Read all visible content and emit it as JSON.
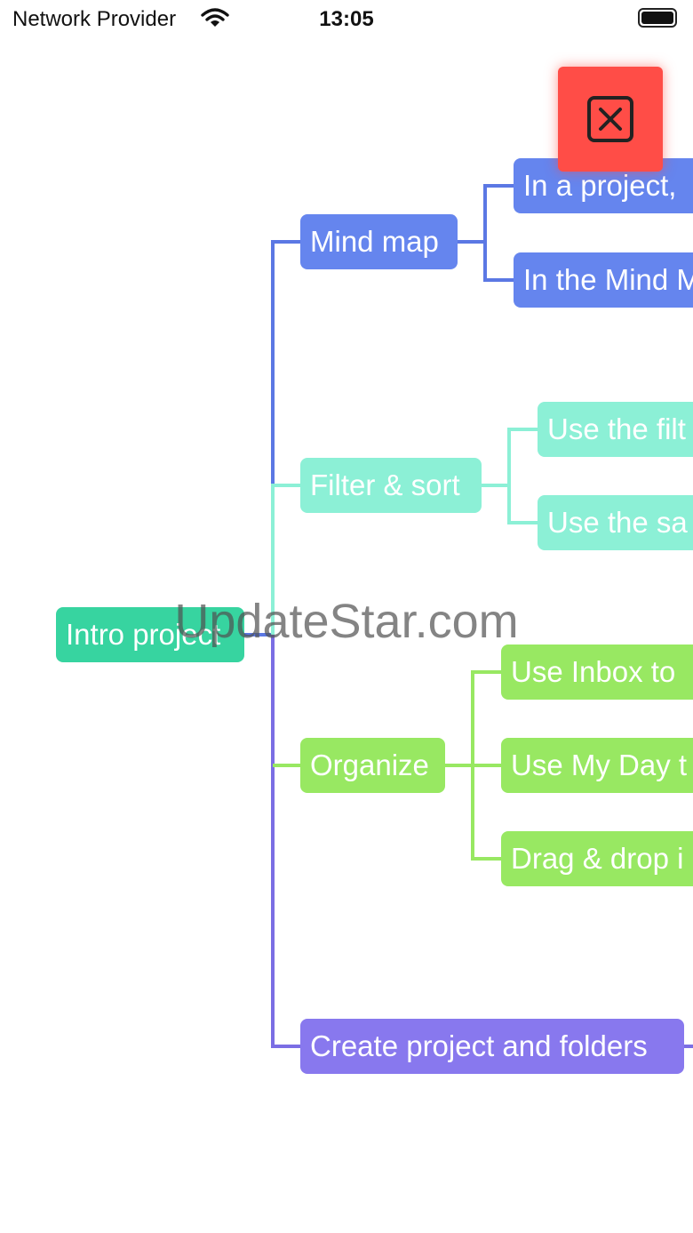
{
  "status_bar": {
    "carrier": "Network Provider",
    "time": "13:05",
    "wifi_icon": "wifi-icon",
    "battery_icon": "battery-icon"
  },
  "mindmap": {
    "root": "Intro project",
    "branches": [
      {
        "label": "Mind map",
        "children": [
          "In a project,",
          "In the Mind M"
        ]
      },
      {
        "label": "Filter & sort",
        "children": [
          "Use the filt",
          "Use the sa"
        ]
      },
      {
        "label": "Organize",
        "children": [
          "Use Inbox to",
          "Use My Day t",
          "Drag & drop i"
        ]
      },
      {
        "label": "Create project and folders",
        "children": []
      }
    ]
  },
  "actions": {
    "delete_icon": "close-box-icon"
  },
  "colors": {
    "root": "#37d4a0",
    "mind_map": "#6585ee",
    "filter_sort": "#8cf0d6",
    "organize": "#98e862",
    "create": "#8878ee",
    "delete": "#ff4d47"
  },
  "watermark": "UpdateStar.com"
}
